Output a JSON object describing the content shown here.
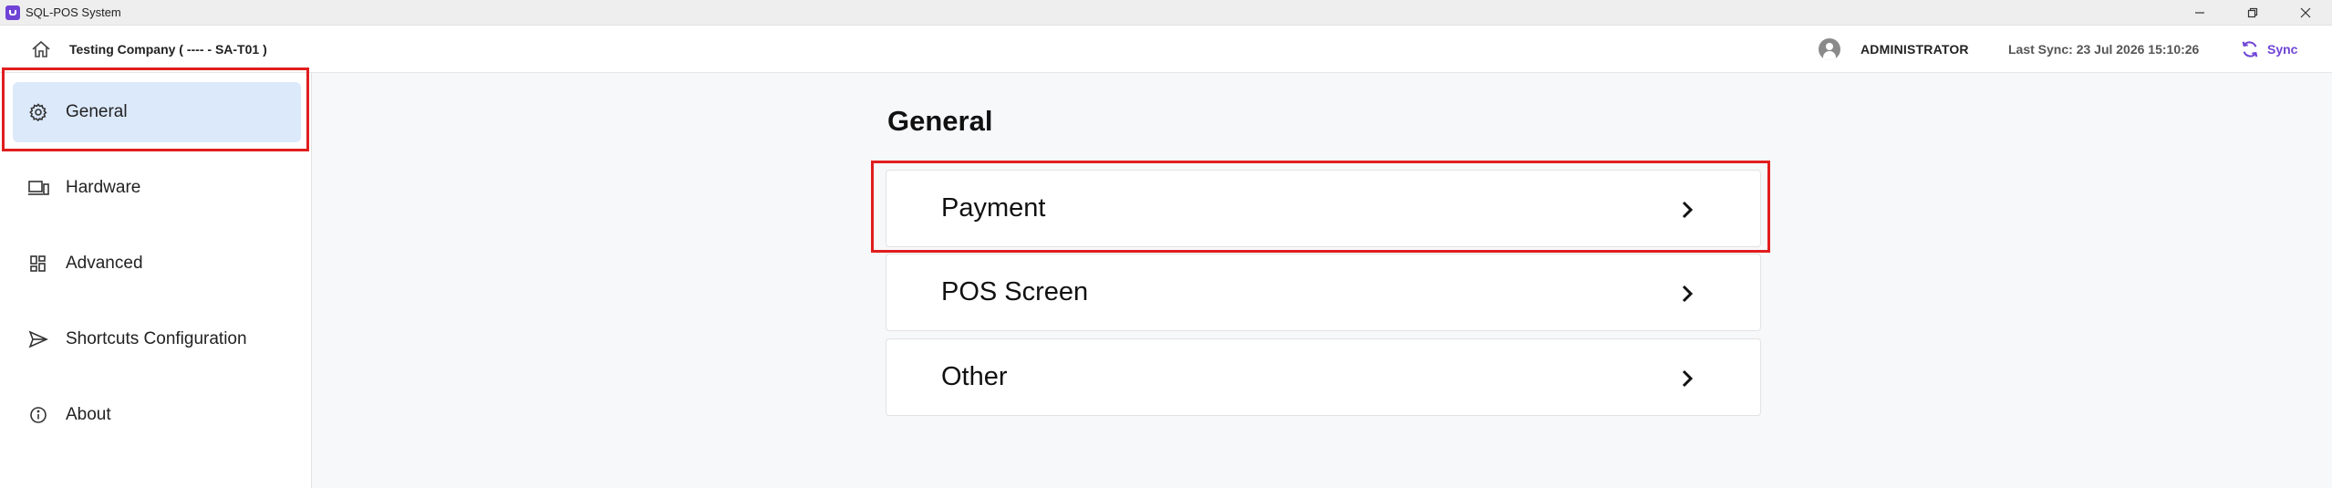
{
  "window": {
    "title": "SQL-POS System",
    "controls": [
      "minimize",
      "restore",
      "close"
    ]
  },
  "header": {
    "company": "Testing Company ( ---- - SA-T01 )",
    "user": "ADMINISTRATOR",
    "last_sync": "Last Sync: 23 Jul 2026 15:10:26",
    "sync_label": "Sync",
    "accent_color": "#6f43d6"
  },
  "sidebar": {
    "items": [
      {
        "label": "General",
        "icon": "gear-icon",
        "active": true
      },
      {
        "label": "Hardware",
        "icon": "devices-icon",
        "active": false
      },
      {
        "label": "Advanced",
        "icon": "grid-icon",
        "active": false
      },
      {
        "label": "Shortcuts Configuration",
        "icon": "send-icon",
        "active": false
      },
      {
        "label": "About",
        "icon": "info-icon",
        "active": false
      }
    ]
  },
  "main": {
    "title": "General",
    "cards": [
      {
        "label": "Payment",
        "icon": "chevron-right-icon"
      },
      {
        "label": "POS Screen",
        "icon": "chevron-right-icon"
      },
      {
        "label": "Other",
        "icon": "chevron-right-icon"
      }
    ]
  },
  "annotations": {
    "highlight_color": "#e01e1e"
  }
}
